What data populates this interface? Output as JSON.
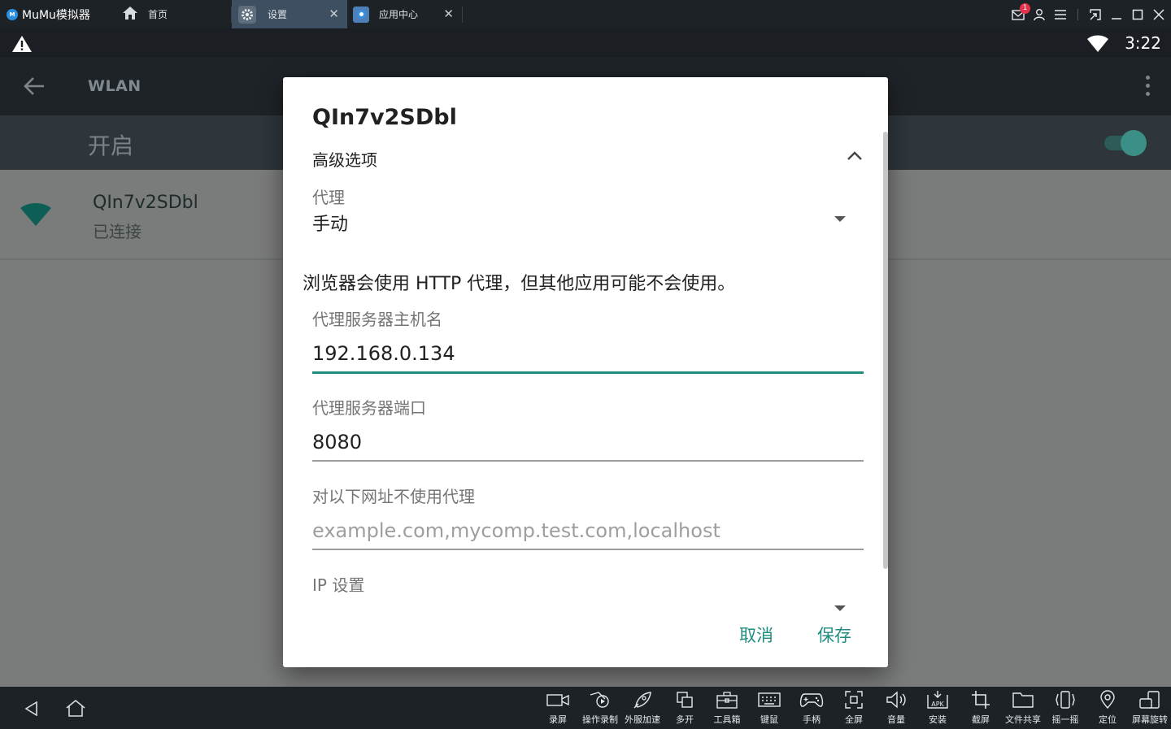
{
  "titlebar": {
    "app_name": "MuMu模拟器",
    "tabs": [
      {
        "label": "首页",
        "icon": "home-icon"
      },
      {
        "label": "设置",
        "icon": "gear-icon"
      },
      {
        "label": "应用中心",
        "icon": "app-center-icon"
      }
    ],
    "notification_count": "1"
  },
  "statusbar": {
    "time": "3:22"
  },
  "settings": {
    "title": "WLAN",
    "switch_label": "开启",
    "network": {
      "name": "QIn7v2SDbl",
      "status": "已连接"
    }
  },
  "dialog": {
    "title": "QIn7v2SDbl",
    "advanced_label": "高级选项",
    "proxy_label": "代理",
    "proxy_value": "手动",
    "proxy_warning": "浏览器会使用 HTTP 代理，但其他应用可能不会使用。",
    "hostname_label": "代理服务器主机名",
    "hostname_value": "192.168.0.134",
    "port_label": "代理服务器端口",
    "port_value": "8080",
    "bypass_label": "对以下网址不使用代理",
    "bypass_placeholder": "example.com,mycomp.test.com,localhost",
    "ip_label": "IP 设置",
    "cancel_label": "取消",
    "save_label": "保存"
  },
  "toolbar": {
    "items": [
      {
        "label": "录屏",
        "icon": "video-record-icon"
      },
      {
        "label": "操作录制",
        "icon": "macro-record-icon"
      },
      {
        "label": "外服加速",
        "icon": "rocket-icon"
      },
      {
        "label": "多开",
        "icon": "multi-instance-icon"
      },
      {
        "label": "工具箱",
        "icon": "toolbox-icon"
      },
      {
        "label": "键鼠",
        "icon": "keyboard-icon"
      },
      {
        "label": "手柄",
        "icon": "gamepad-icon"
      },
      {
        "label": "全屏",
        "icon": "fullscreen-icon"
      },
      {
        "label": "音量",
        "icon": "volume-icon"
      },
      {
        "label": "安装",
        "icon": "apk-install-icon"
      },
      {
        "label": "截屏",
        "icon": "crop-icon"
      },
      {
        "label": "文件共享",
        "icon": "folder-share-icon"
      },
      {
        "label": "摇一摇",
        "icon": "shake-icon"
      },
      {
        "label": "定位",
        "icon": "location-icon"
      },
      {
        "label": "屏幕旋转",
        "icon": "rotate-icon"
      }
    ]
  },
  "colors": {
    "accent": "#1f8c7f",
    "titlebar_bg": "#1d2226",
    "active_tab_bg": "#3d4f60",
    "scrim_content": "#7a7b7b"
  }
}
